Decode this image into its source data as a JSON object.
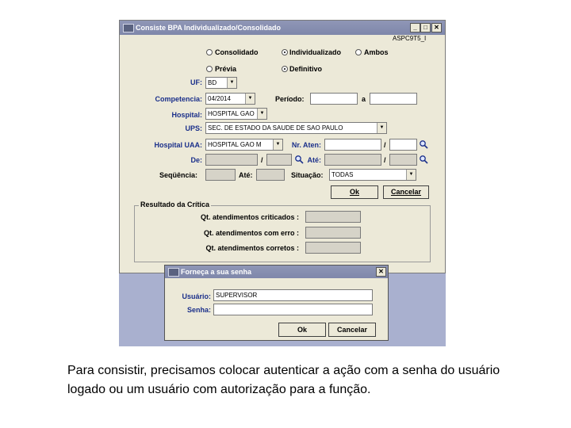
{
  "main_window": {
    "title": "Consiste BPA Individualizado/Consolidado",
    "buttons": {
      "minimize": "_",
      "maximize": "□",
      "close": "✕"
    },
    "code": "ASPC9T5_I",
    "radios": {
      "consolidado": "Consolidado",
      "individualizado": "Individualizado",
      "ambos": "Ambos",
      "previa": "Prévia",
      "definitivo": "Definitivo"
    },
    "labels": {
      "uf": "UF:",
      "competencia": "Competencia:",
      "periodo": "Período:",
      "a": "a",
      "hospital": "Hospital:",
      "ups": "UPS:",
      "hospital_uaa": "Hospital UAA:",
      "nr_aten": "Nr. Aten:",
      "de": "De:",
      "ate": "Até:",
      "sequencia": "Seqüência:",
      "ate2": "Até:",
      "situacao": "Situação:",
      "slash": "/"
    },
    "values": {
      "uf": "BD",
      "competencia": "04/2014",
      "hospital": "HOSPITAL GAO",
      "ups": "SEC. DE ESTADO DA SAUDE DE SAO PAULO",
      "hospital_uaa": "HOSPITAL GAO M",
      "situacao": "TODAS"
    },
    "ok_label": "Ok",
    "cancel_label": "Cancelar",
    "result_group": {
      "title": "Resultado da Crítica",
      "rows": [
        "Qt. atendimentos criticados :",
        "Qt. atendimentos com erro :",
        "Qt. atendimentos corretos :"
      ]
    }
  },
  "password_dialog": {
    "title": "Forneça a sua senha",
    "close": "✕",
    "usuario_label": "Usuário:",
    "usuario_value": "SUPERVISOR",
    "senha_label": "Senha:",
    "ok_label": "Ok",
    "cancel_label": "Cancelar"
  },
  "caption": "Para consistir, precisamos colocar autenticar a ação com a senha do usuário logado ou um usuário com autorização para a função."
}
